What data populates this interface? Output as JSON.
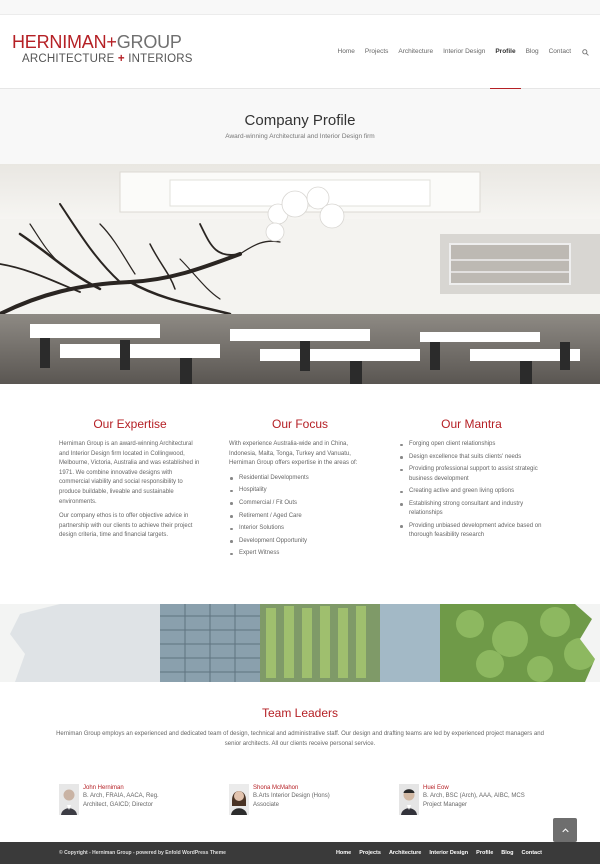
{
  "logo": {
    "word1": "HERNIMAN",
    "plus": "+",
    "word2": "GROUP",
    "line2a": "ARCHITECTURE",
    "line2b": "INTERIORS"
  },
  "nav": {
    "items": [
      {
        "label": "Home"
      },
      {
        "label": "Projects"
      },
      {
        "label": "Architecture"
      },
      {
        "label": "Interior Design"
      },
      {
        "label": "Profile"
      },
      {
        "label": "Blog"
      },
      {
        "label": "Contact"
      }
    ],
    "active": "Profile",
    "search_icon": "search-icon"
  },
  "page": {
    "title": "Company Profile",
    "subtitle": "Award-winning Architectural and Interior Design firm"
  },
  "colors": {
    "accent": "#b52025",
    "footer_bg": "#3a3a3a",
    "titlebar_bg": "#f8f8f8"
  },
  "expertise": {
    "heading": "Our Expertise",
    "p1": "Herniman Group is an award-winning Architectural and Interior Design firm located in Collingwood, Melbourne, Victoria, Australia and was established in 1971. We combine innovative designs with commercial viability and social responsibility to produce buildable, liveable and sustainable environments.",
    "p2": "Our company ethos is to offer objective advice in partnership with our clients to achieve their project design criteria, time and financial targets."
  },
  "focus": {
    "heading": "Our Focus",
    "intro": "With experience Australia-wide and in China, Indonesia, Malta, Tonga, Turkey and Vanuatu, Herniman Group offers expertise in the areas of:",
    "items": [
      "Residential Developments",
      "Hospitality",
      "Commercial / Fit Outs",
      "Retirement / Aged Care",
      "Interior Solutions",
      "Development Opportunity",
      "Expert Witness"
    ]
  },
  "mantra": {
    "heading": "Our Mantra",
    "items": [
      "Forging open client relationships",
      "Design excellence that suits clients' needs",
      "Providing professional support to assist strategic business development",
      "Creating active and green living options",
      "Establishing strong consultant and industry relationships",
      "Providing unbiased development advice based on thorough feasibility research"
    ]
  },
  "team": {
    "heading": "Team Leaders",
    "intro": "Herniman Group employs an experienced and dedicated team of design, technical and administrative staff. Our design and drafting teams are led by experienced project managers and senior architects. All our clients receive personal service.",
    "members": [
      {
        "name": "John Herniman",
        "role1": "B. Arch, FRAIA, AACA, Reg.",
        "role2": "Architect, GAICD; Director"
      },
      {
        "name": "Shona McMahon",
        "role1": "B.Arts Interior Design (Hons)",
        "role2": "Associate"
      },
      {
        "name": "Huei Eow",
        "role1": "B. Arch, BSC (Arch), AAA, AIBC, MCS",
        "role2": "Project Manager"
      }
    ]
  },
  "footer": {
    "copyright": "© Copyright - Herniman Group - powered by Enfold WordPress Theme",
    "links": [
      {
        "label": "Home"
      },
      {
        "label": "Projects"
      },
      {
        "label": "Architecture"
      },
      {
        "label": "Interior Design"
      },
      {
        "label": "Profile"
      },
      {
        "label": "Blog"
      },
      {
        "label": "Contact"
      }
    ]
  },
  "scroll_top_icon": "chevron-up-icon"
}
